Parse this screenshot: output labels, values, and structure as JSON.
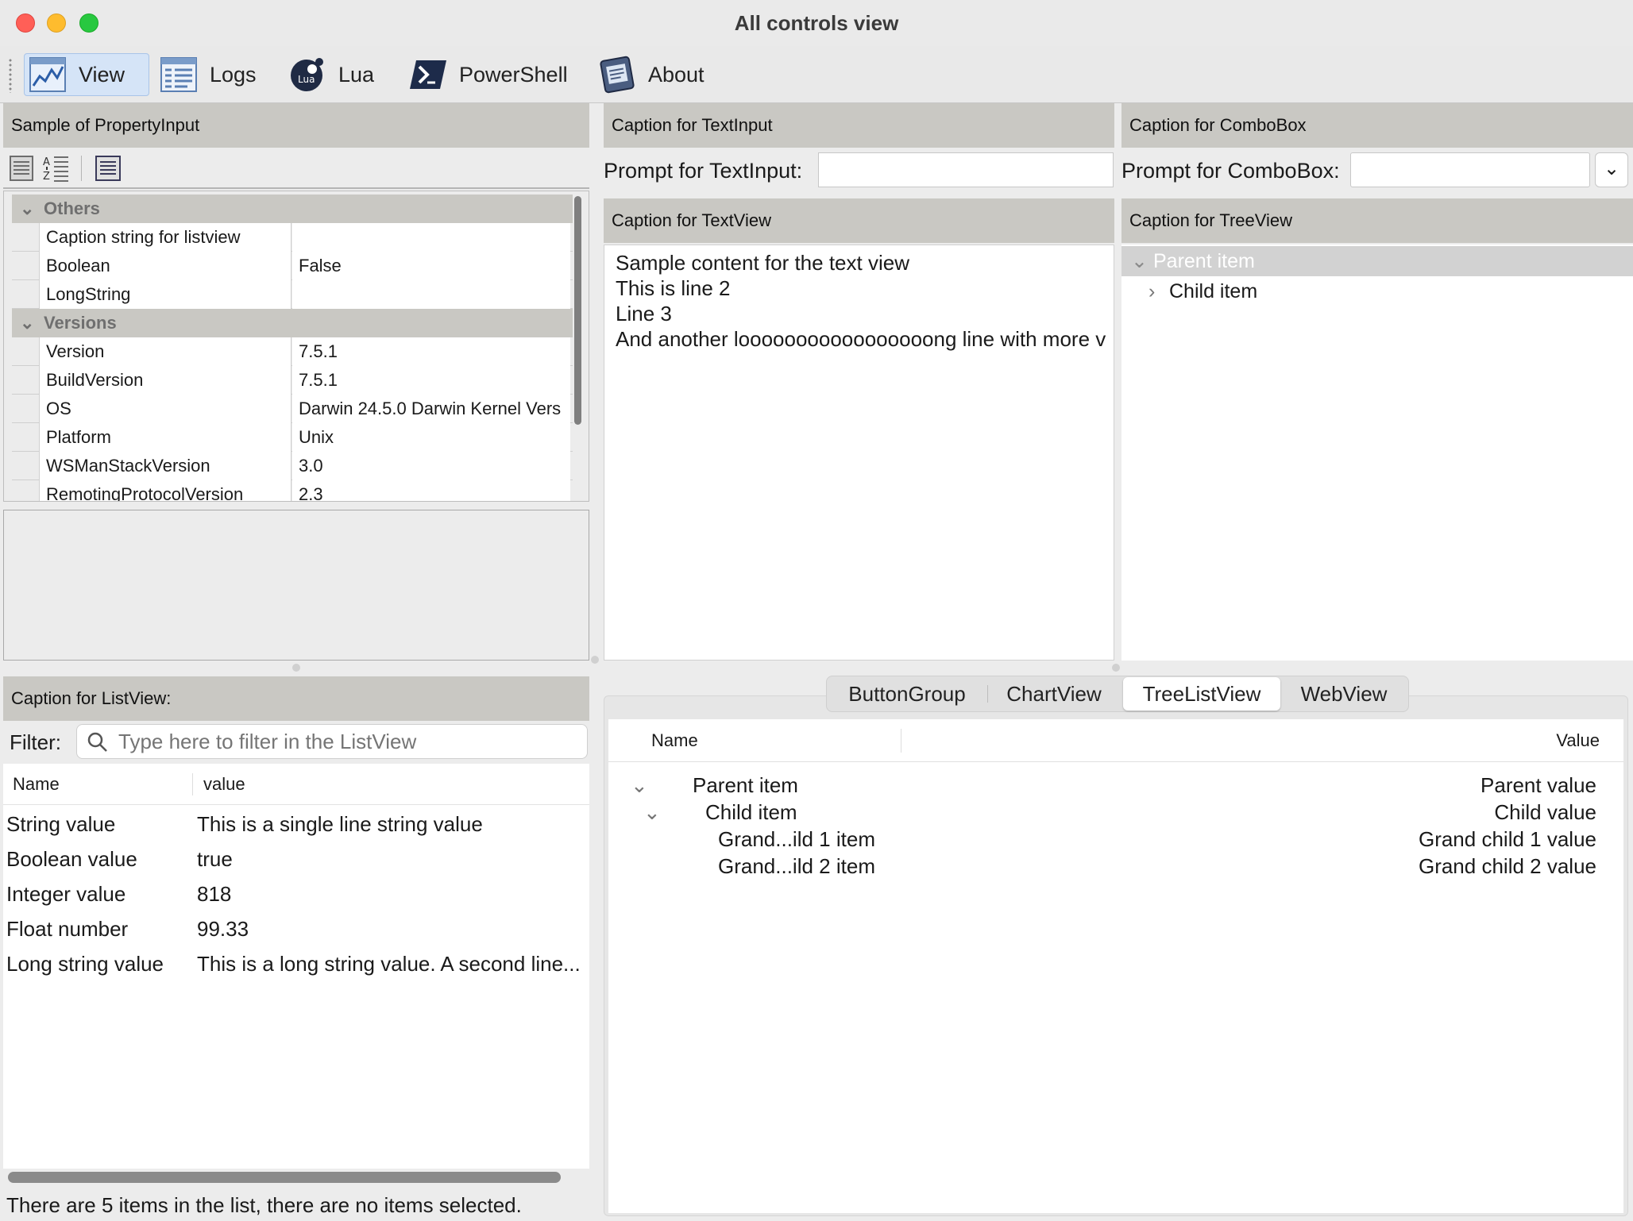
{
  "window": {
    "title": "All controls view",
    "colors": {
      "close": "#ff5f57",
      "minimize": "#febc2e",
      "zoom": "#28c840"
    }
  },
  "toolbar": {
    "items": [
      {
        "label": "View",
        "icon": "chart-icon",
        "active": true
      },
      {
        "label": "Logs",
        "icon": "logs-icon"
      },
      {
        "label": "Lua",
        "icon": "lua-icon"
      },
      {
        "label": "PowerShell",
        "icon": "powershell-icon"
      },
      {
        "label": "About",
        "icon": "about-icon"
      }
    ]
  },
  "property_input": {
    "caption": "Sample of PropertyInput",
    "tools": [
      "categorized-icon",
      "alphabetical-icon",
      "properties-icon"
    ],
    "categories": [
      {
        "name": "Others",
        "rows": [
          {
            "key": "Caption string for listview",
            "value": ""
          },
          {
            "key": "Boolean",
            "value": "False"
          },
          {
            "key": "LongString",
            "value": ""
          }
        ]
      },
      {
        "name": "Versions",
        "rows": [
          {
            "key": "Version",
            "value": "7.5.1"
          },
          {
            "key": "BuildVersion",
            "value": "7.5.1"
          },
          {
            "key": "OS",
            "value": "Darwin 24.5.0 Darwin Kernel Vers"
          },
          {
            "key": "Platform",
            "value": "Unix"
          },
          {
            "key": "WSManStackVersion",
            "value": "3.0"
          },
          {
            "key": "RemotingProtocolVersion",
            "value": "2.3"
          }
        ]
      }
    ]
  },
  "text_input": {
    "caption": "Caption for TextInput",
    "prompt": "Prompt for TextInput:",
    "value": ""
  },
  "combo_box": {
    "caption": "Caption for ComboBox",
    "prompt": "Prompt for ComboBox:",
    "value": ""
  },
  "text_view": {
    "caption": "Caption for TextView",
    "lines": [
      "Sample content for the text view",
      "This is line 2",
      "Line 3",
      "And another looooooooooooooooong line with more v"
    ]
  },
  "tree_view": {
    "caption": "Caption for TreeView",
    "items": [
      {
        "label": "Parent item"
      },
      {
        "label": "Child item"
      }
    ]
  },
  "list_view": {
    "caption": "Caption for ListView:",
    "filter_label": "Filter:",
    "filter_placeholder": "Type here to filter in the ListView",
    "columns": [
      "Name",
      "value"
    ],
    "rows": [
      {
        "name": "String value",
        "value": "This is a single line string value"
      },
      {
        "name": "Boolean value",
        "value": "true"
      },
      {
        "name": "Integer value",
        "value": "818"
      },
      {
        "name": "Float number",
        "value": "99.33"
      },
      {
        "name": "Long string value",
        "value": "This is a long string value. A second line..."
      }
    ],
    "status": "There are 5 items in the list, there are no items selected."
  },
  "tabs": {
    "items": [
      "ButtonGroup",
      "ChartView",
      "TreeListView",
      "WebView"
    ],
    "selected": "TreeListView"
  },
  "tree_list": {
    "columns": [
      "Name",
      "Value"
    ],
    "rows": [
      {
        "name": "Parent item",
        "value": "Parent value"
      },
      {
        "name": "Child item",
        "value": "Child value"
      },
      {
        "name": "Grand...ild 1 item",
        "value": "Grand child 1 value"
      },
      {
        "name": "Grand...ild 2 item",
        "value": "Grand child 2 value"
      }
    ]
  }
}
